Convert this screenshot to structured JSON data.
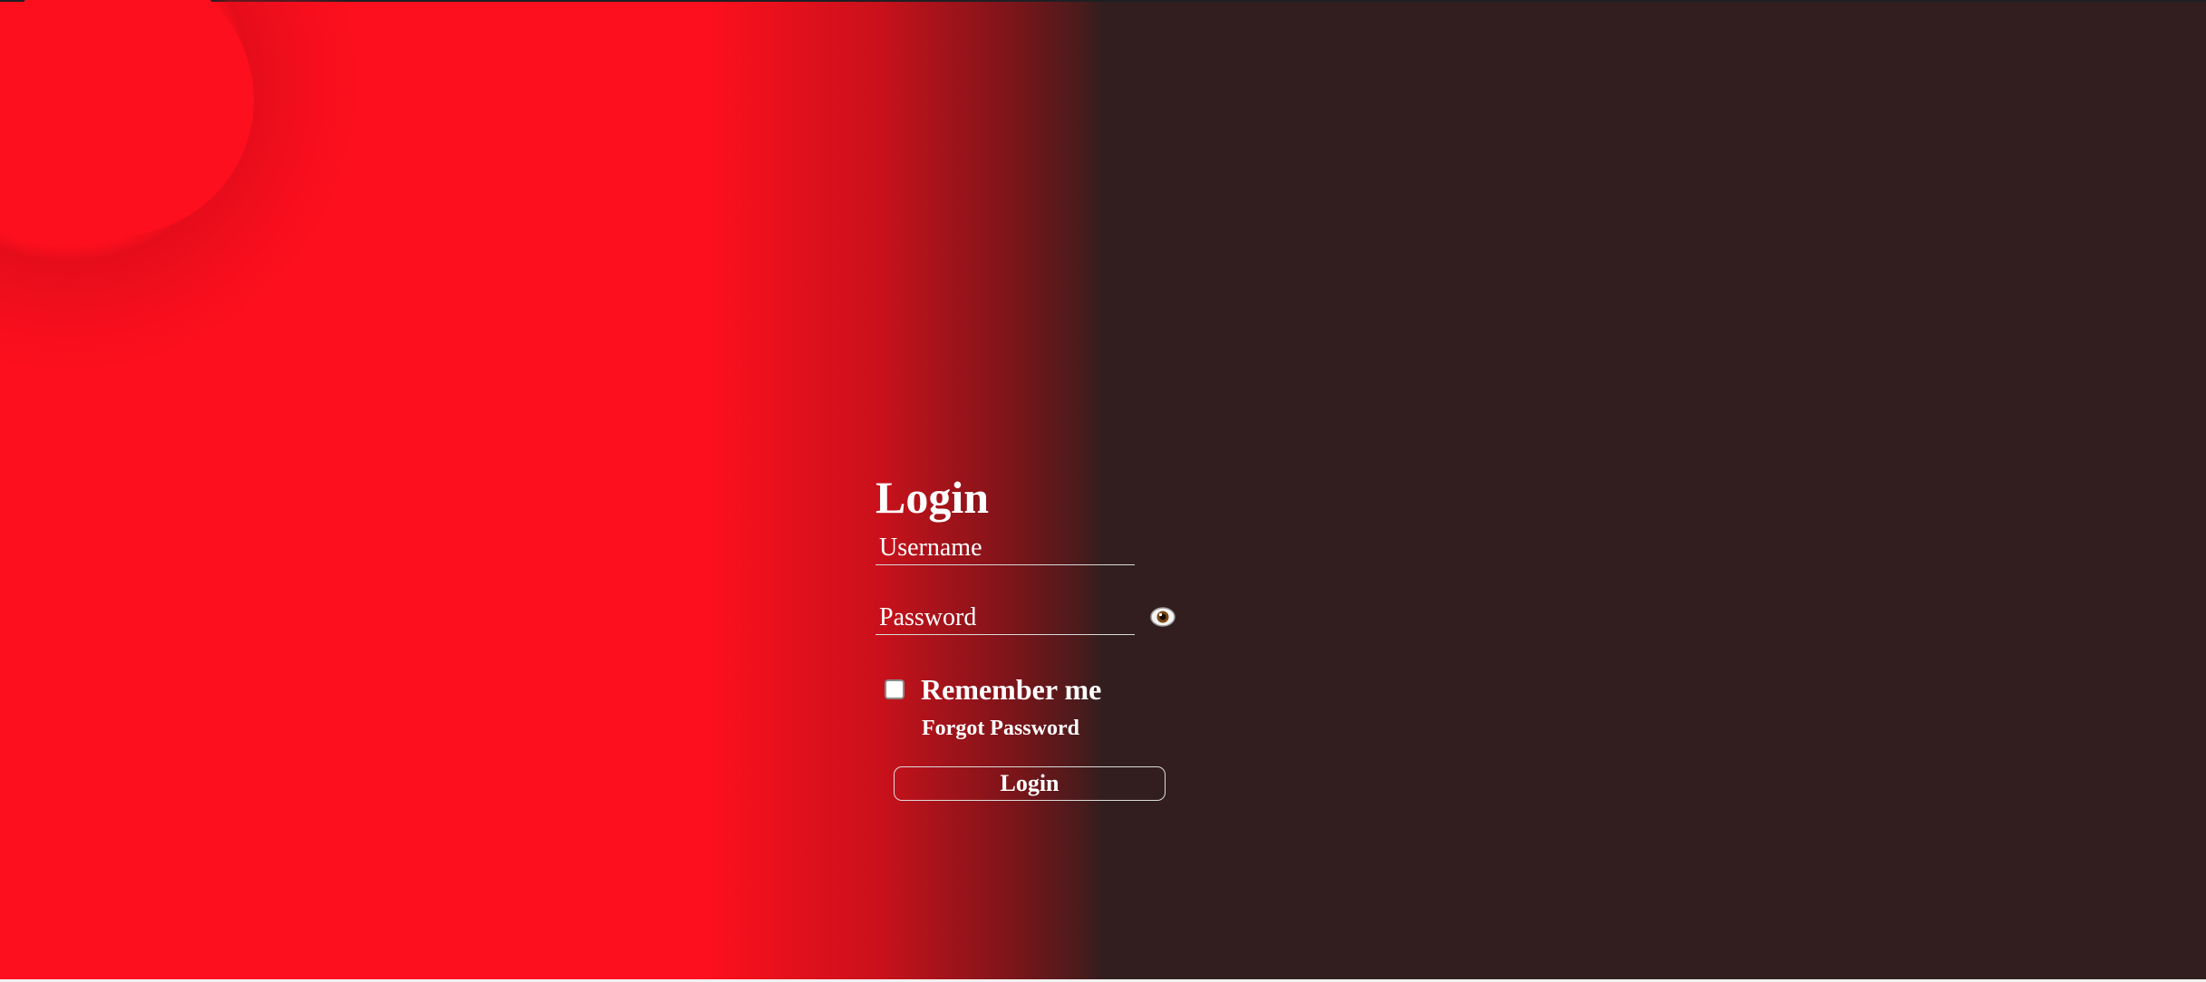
{
  "login": {
    "title": "Login",
    "username_placeholder": "Username",
    "password_placeholder": "Password",
    "show_password_icon": "eye-icon",
    "remember_label": "Remember me",
    "remember_checked": false,
    "forgot_link": "Forgot Password",
    "submit_label": "Login"
  },
  "colors": {
    "accent_red": "#fe0f1d",
    "dark_background": "#321e1e",
    "text": "#ffffff"
  }
}
